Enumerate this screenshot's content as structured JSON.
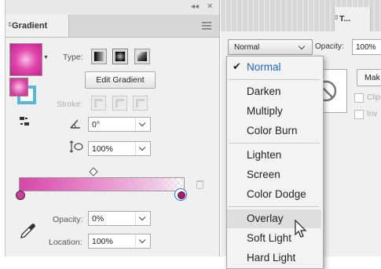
{
  "gradient_panel": {
    "title": "Gradient",
    "type_label": "Type:",
    "edit_gradient_label": "Edit Gradient",
    "stroke_label": "Stroke:",
    "angle_value": "0°",
    "aspect_value": "100%",
    "opacity_label": "Opacity:",
    "opacity_value": "0%",
    "location_label": "Location:",
    "location_value": "100%",
    "topbar_collapse": "◂◂",
    "topbar_close": "✕"
  },
  "transparency_panel": {
    "tab_label": "T...",
    "blend_mode_value": "Normal",
    "opacity_label": "Opacity:",
    "opacity_value": "100%",
    "make_mask_label": "Mak",
    "clip_label": "Clip",
    "invert_label": "Inv"
  },
  "blend_menu": {
    "groups": [
      [
        "Normal"
      ],
      [
        "Darken",
        "Multiply",
        "Color Burn"
      ],
      [
        "Lighten",
        "Screen",
        "Color Dodge"
      ],
      [
        "Overlay",
        "Soft Light",
        "Hard Light"
      ]
    ],
    "items": [
      "Normal",
      "Darken",
      "Multiply",
      "Color Burn",
      "Lighten",
      "Screen",
      "Color Dodge",
      "Overlay",
      "Soft Light",
      "Hard Light"
    ],
    "selected": "Normal",
    "hovered": "Overlay"
  },
  "colors": {
    "gradient_start": "#d646a8",
    "gradient_end": "#b0136c",
    "selected_text": "#1c64c8",
    "focus_ring": "#2d6cf0"
  },
  "icons": {
    "checkmark": "✔"
  }
}
